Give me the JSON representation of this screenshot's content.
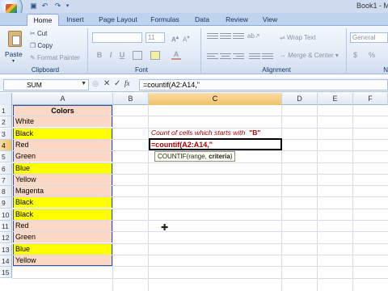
{
  "window": {
    "title": "Book1 - M"
  },
  "quick_access": {
    "icons": [
      "save-icon",
      "undo-icon",
      "redo-icon"
    ]
  },
  "tabs": [
    {
      "label": "Home",
      "active": true
    },
    {
      "label": "Insert"
    },
    {
      "label": "Page Layout"
    },
    {
      "label": "Formulas"
    },
    {
      "label": "Data"
    },
    {
      "label": "Review"
    },
    {
      "label": "View"
    }
  ],
  "ribbon": {
    "clipboard": {
      "paste_label": "Paste",
      "cut_label": "Cut",
      "copy_label": "Copy",
      "format_painter_label": "Format Painter",
      "group_label": "Clipboard"
    },
    "font": {
      "font_size": "11",
      "bold": "B",
      "italic": "I",
      "underline": "U",
      "group_label": "Font"
    },
    "alignment": {
      "wrap_text_label": "Wrap Text",
      "merge_center_label": "Merge & Center",
      "group_label": "Alignment"
    },
    "number": {
      "format": "General",
      "currency": "$",
      "percent": "%",
      "group_label": "N"
    }
  },
  "formula_bar": {
    "name_box": "SUM",
    "fx_label": "fx",
    "formula": "=countif(A2:A14,\""
  },
  "columns": [
    "A",
    "B",
    "C",
    "D",
    "E",
    "F"
  ],
  "rows": [
    "1",
    "2",
    "3",
    "4",
    "5",
    "6",
    "7",
    "8",
    "9",
    "10",
    "11",
    "12",
    "13",
    "14",
    "15"
  ],
  "column_a": {
    "header": "Colors",
    "values": [
      "White",
      "Black",
      "Red",
      "Green",
      "Blue",
      "Yellow",
      "Magenta",
      "Black",
      "Black",
      "Red",
      "Green",
      "Blue",
      "Yellow"
    ],
    "fills": [
      "#fbd9c6",
      "#ffff00",
      "#fbd9c6",
      "#fbd9c6",
      "#ffff00",
      "#fbd9c6",
      "#fbd9c6",
      "#ffff00",
      "#ffff00",
      "#fbd9c6",
      "#fbd9c6",
      "#ffff00",
      "#fbd9c6"
    ]
  },
  "cells": {
    "c3_note": "Count of cells which starts with",
    "c3_value": "\"B\"",
    "c4_entry": "=countif(A2:A14,\"",
    "tooltip": {
      "func": "COUNTIF(range, ",
      "bold_arg": "criteria",
      "close": ")"
    }
  },
  "colors": {
    "accent_border": "#2e4f9a",
    "header_fill": "#fbd9c6",
    "highlight_fill": "#ffff00",
    "note_text": "#b00000"
  }
}
